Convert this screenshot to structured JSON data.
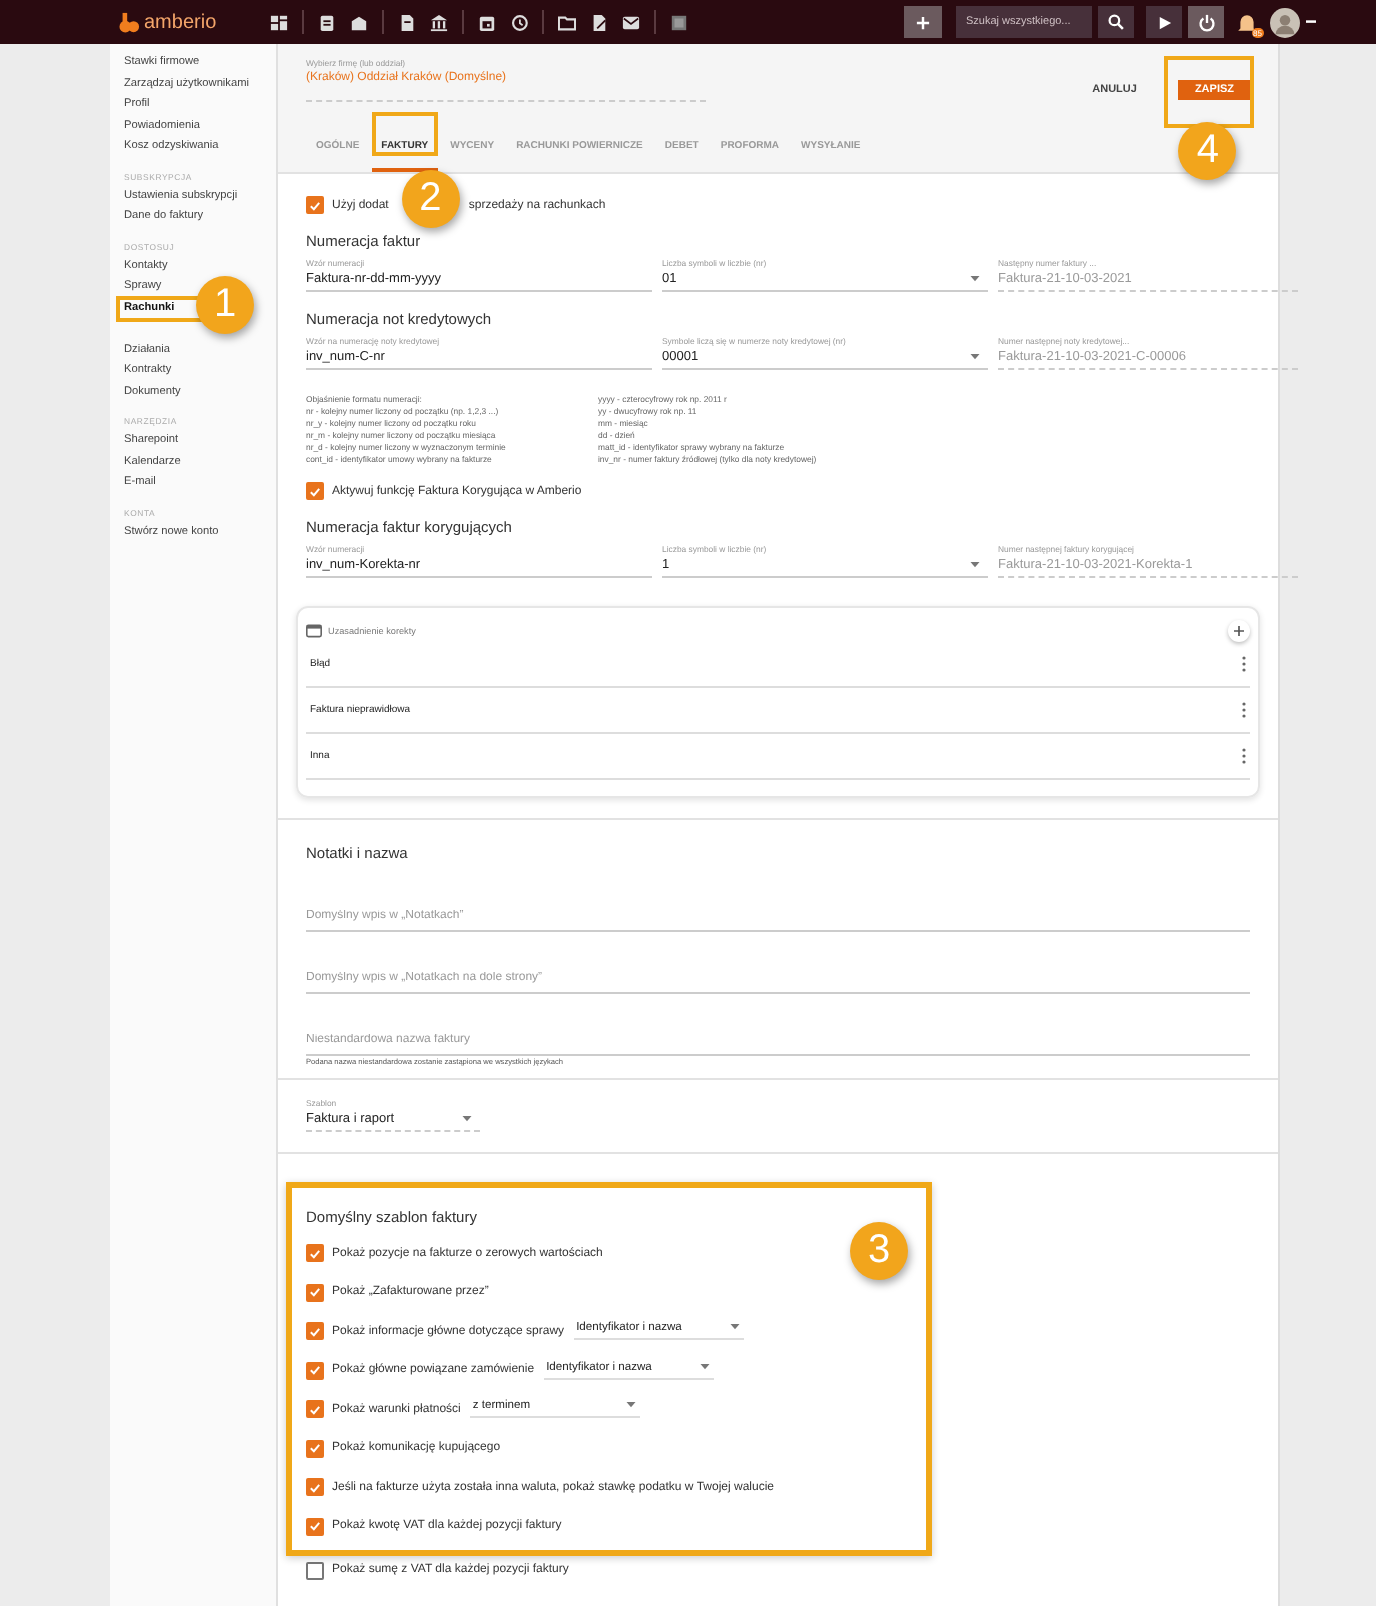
{
  "topbar": {
    "logo": "amberio",
    "search": {
      "placeholder": "Szukaj wszystkiego..."
    },
    "notifications_badge": "85"
  },
  "sidebar": {
    "groups": [
      {
        "items": [
          {
            "label": "Stawki firmowe",
            "selected": false
          },
          {
            "label": "Zarządzaj użytkownikami",
            "selected": false
          },
          {
            "label": "Profil",
            "selected": false
          },
          {
            "label": "Powiadomienia",
            "selected": false
          },
          {
            "label": "Kosz odzyskiwania",
            "selected": false
          }
        ]
      },
      {
        "heading": "SUBSKRYPCJA",
        "items": [
          {
            "label": "Ustawienia subskrypcji",
            "selected": false
          },
          {
            "label": "Dane do faktury",
            "selected": false
          }
        ]
      },
      {
        "heading": "DOSTOSUJ",
        "items": [
          {
            "label": "Kontakty",
            "selected": false
          },
          {
            "label": "Sprawy",
            "selected": false
          },
          {
            "label": "Rachunki",
            "selected": true,
            "callout": "1"
          },
          {
            "label": "Działania",
            "selected": false
          },
          {
            "label": "Kontrakty",
            "selected": false
          },
          {
            "label": "Dokumenty",
            "selected": false
          }
        ]
      },
      {
        "heading": "NARZĘDZIA",
        "items": [
          {
            "label": "Sharepoint",
            "selected": false
          },
          {
            "label": "Kalendarze",
            "selected": false
          },
          {
            "label": "E-mail",
            "selected": false
          }
        ]
      },
      {
        "heading": "KONTA",
        "items": [
          {
            "label": "Stwórz nowe konto",
            "selected": false
          }
        ]
      }
    ]
  },
  "header": {
    "company": {
      "label": "Wybierz firmę (lub oddział)",
      "value": "(Kraków) Oddział Kraków (Domyślne)"
    },
    "buttons": [
      {
        "label": "ANULUJ",
        "kind": "text"
      },
      {
        "label": "ZAPISZ",
        "kind": "primary",
        "callout": "4"
      }
    ],
    "tabs": [
      {
        "label": "OGÓLNE",
        "selected": false
      },
      {
        "label": "FAKTURY",
        "selected": true,
        "callout": "2"
      },
      {
        "label": "WYCENY",
        "selected": false
      },
      {
        "label": "RACHUNKI POWIERNICZE",
        "selected": false
      },
      {
        "label": "DEBET",
        "selected": false
      },
      {
        "label": "PROFORMA",
        "selected": false
      },
      {
        "label": "WYSYŁANIE",
        "selected": false
      }
    ]
  },
  "top_checkbox": {
    "label_parts": [
      "Użyj dodat",
      "sprzedaży na rachunkach"
    ],
    "checked": true
  },
  "invoice_numbering": {
    "title": "Numeracja faktur",
    "fields": [
      {
        "label": "Wzór numeracji",
        "value": "Faktura-nr-dd-mm-yyyy",
        "kind": "text"
      },
      {
        "label": "Liczba symboli w liczbie (nr)",
        "value": "01",
        "kind": "select"
      },
      {
        "label": "Następny numer faktury ...",
        "value": "Faktura-21-10-03-2021",
        "kind": "readonly"
      }
    ]
  },
  "credit_note_numbering": {
    "title": "Numeracja not kredytowych",
    "fields": [
      {
        "label": "Wzór na numerację noty kredytowej",
        "value": "inv_num-C-nr",
        "kind": "text"
      },
      {
        "label": "Symbole liczą się w numerze noty kredytowej (nr)",
        "value": "00001",
        "kind": "select"
      },
      {
        "label": "Numer następnej noty kredytowej...",
        "value": "Faktura-21-10-03-2021-C-00006",
        "kind": "readonly"
      }
    ]
  },
  "format_help": {
    "left": [
      "Objaśnienie formatu numeracji:",
      "nr - kolejny numer liczony od początku (np. 1,2,3 ...)",
      "nr_y - kolejny numer liczony od początku roku",
      "nr_m - kolejny numer liczony od początku miesiąca",
      "nr_d - kolejny numer liczony w wyznaczonym terminie",
      "cont_id - identyfikator umowy wybrany na fakturze"
    ],
    "right": [
      "yyyy - czterocyfrowy rok np. 2011 r",
      "yy - dwucyfrowy rok np. 11",
      "mm - miesiąc",
      "dd - dzień",
      "matt_id - identyfikator sprawy wybrany na fakturze",
      "inv_nr - numer faktury źródłowej (tylko dla noty kredytowej)"
    ]
  },
  "correction_checkbox": {
    "label": "Aktywuj funkcję Faktura Korygująca w Amberio",
    "checked": true
  },
  "correction_numbering": {
    "title": "Numeracja faktur korygujących",
    "fields": [
      {
        "label": "Wzór numeracji",
        "value": "inv_num-Korekta-nr",
        "kind": "text"
      },
      {
        "label": "Liczba symboli w liczbie (nr)",
        "value": "1",
        "kind": "select"
      },
      {
        "label": "Numer następnej faktury korygującej",
        "value": "Faktura-21-10-03-2021-Korekta-1",
        "kind": "readonly"
      }
    ]
  },
  "reasons": {
    "title": "Uzasadnienie korekty",
    "items": [
      "Błąd",
      "Faktura nieprawidłowa",
      "Inna"
    ]
  },
  "notes": {
    "title": "Notatki i nazwa",
    "fields": [
      {
        "placeholder": "Domyślny wpis w „Notatkach”"
      },
      {
        "placeholder": "Domyślny wpis w „Notatkach na dole strony”"
      },
      {
        "placeholder": "Niestandardowa nazwa faktury",
        "hint": "Podana nazwa niestandardowa zostanie zastąpiona we wszystkich językach"
      }
    ]
  },
  "template_select": {
    "label": "Szablon",
    "value": "Faktura i raport"
  },
  "default_template": {
    "title": "Domyślny szablon faktury",
    "callout": "3",
    "options": [
      {
        "label": "Pokaż pozycje na fakturze o zerowych wartościach",
        "checked": true
      },
      {
        "label": "Pokaż „Zafakturowane przez”",
        "checked": true
      },
      {
        "label": "Pokaż informacje główne dotyczące sprawy",
        "checked": true,
        "select": "Identyfikator i nazwa"
      },
      {
        "label": "Pokaż główne powiązane zamówienie",
        "checked": true,
        "select": "Identyfikator i nazwa"
      },
      {
        "label": "Pokaż warunki płatności",
        "checked": true,
        "select": "z terminem"
      },
      {
        "label": "Pokaż komunikację kupującego",
        "checked": true
      },
      {
        "label": "Jeśli na fakturze użyta została inna waluta, pokaż stawkę podatku w Twojej walucie",
        "checked": true
      },
      {
        "label": "Pokaż kwotę VAT dla każdej pozycji faktury",
        "checked": true
      }
    ],
    "after_options": [
      {
        "label": "Pokaż sumę z VAT dla każdej pozycji faktury",
        "checked": false
      }
    ]
  }
}
